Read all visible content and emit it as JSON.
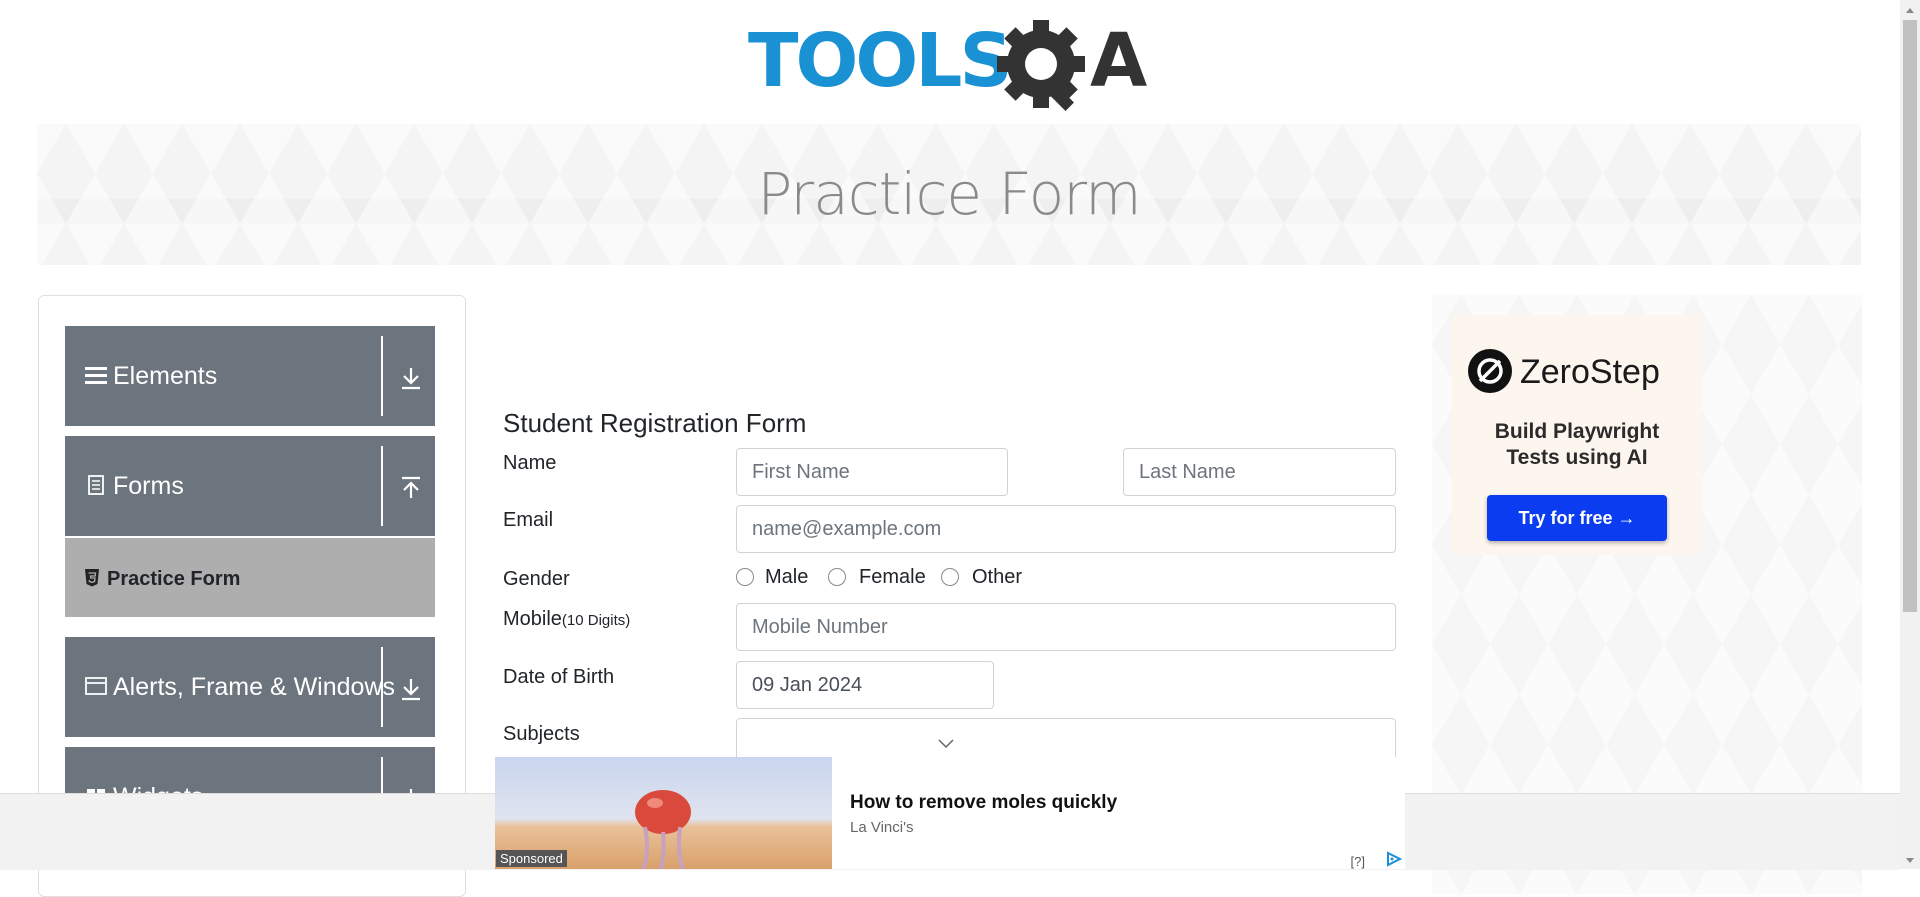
{
  "header": {
    "logo_text": "TOOLSQA",
    "banner_title": "Practice Form"
  },
  "sidebar": {
    "groups": [
      {
        "label": "Elements",
        "icon": "hamburger-icon",
        "toggle": "download-icon"
      },
      {
        "label": "Forms",
        "icon": "document-icon",
        "toggle": "upload-icon"
      },
      {
        "label": "Alerts, Frame & Windows",
        "icon": "window-icon",
        "toggle": "download-icon"
      },
      {
        "label": "Widgets",
        "icon": "widgets-icon",
        "toggle": "download-icon"
      }
    ],
    "active_item": {
      "label": "Practice Form",
      "icon": "html5-icon"
    }
  },
  "form": {
    "title": "Student Registration Form",
    "name_label": "Name",
    "first_name_placeholder": "First Name",
    "last_name_placeholder": "Last Name",
    "email_label": "Email",
    "email_placeholder": "name@example.com",
    "gender_label": "Gender",
    "gender_options": [
      "Male",
      "Female",
      "Other"
    ],
    "mobile_label": "Mobile",
    "mobile_hint": "(10 Digits)",
    "mobile_placeholder": "Mobile Number",
    "dob_label": "Date of Birth",
    "dob_value": "09 Jan 2024",
    "subjects_label": "Subjects"
  },
  "right_ad": {
    "brand": "ZeroStep",
    "tagline_line1": "Build Playwright",
    "tagline_line2": "Tests using AI",
    "cta": "Try for free →"
  },
  "bottom_ad": {
    "badge": "Sponsored",
    "headline": "How to remove moles quickly",
    "source": "La Vinci's",
    "marker": "[?]"
  },
  "colors": {
    "accent_blue": "#1991d2",
    "sidebar_gray": "#6c757d",
    "active_item_gray": "#aeaeae",
    "cta_blue": "#0b3cf0"
  }
}
